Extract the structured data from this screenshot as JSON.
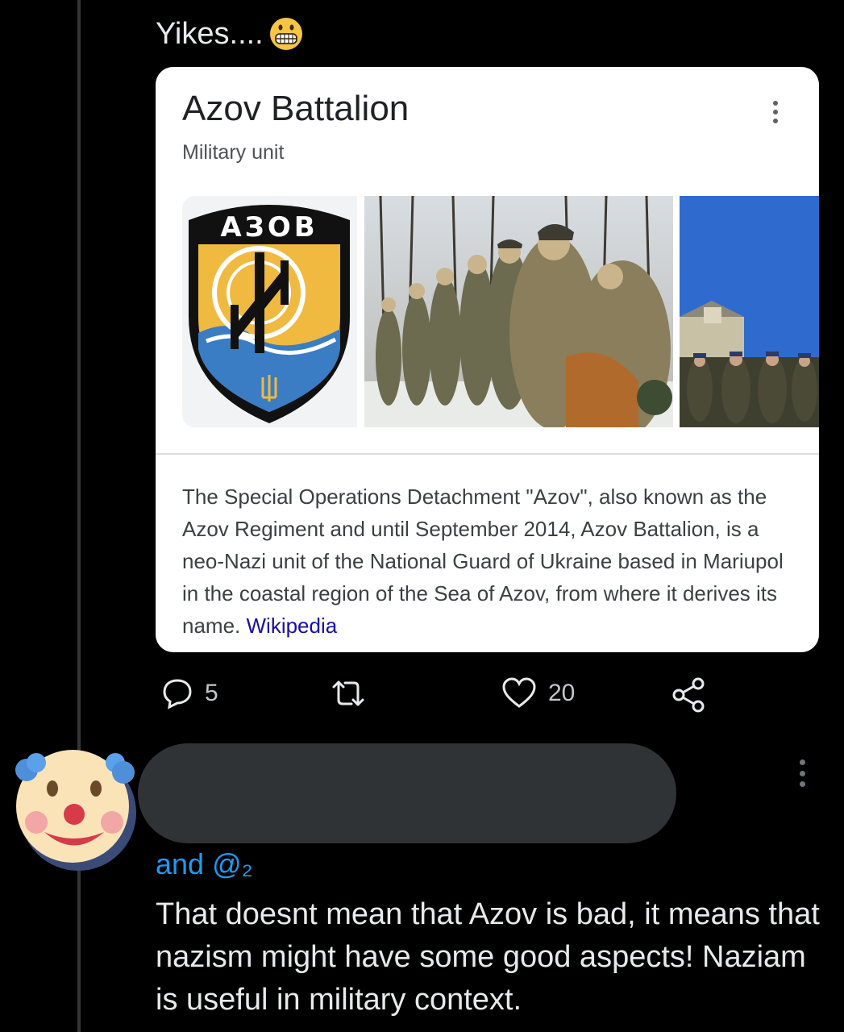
{
  "tweet": {
    "text": "Yikes....",
    "emoji": "grimacing-face-emoji"
  },
  "card": {
    "title": "Azov Battalion",
    "subtitle": "Military unit",
    "emblem_text": "АЗОВ",
    "description": "The Special Operations Detachment \"Azov\", also known as the Azov Regiment and until September 2014, Azov Battalion, is a neo-Nazi unit of the National Guard of Ukraine based in Mariupol in the coastal region of the Sea of Azov, from where it derives its name.",
    "source_link": "Wikipedia",
    "menu_icon": "more-vert-icon"
  },
  "actions": {
    "reply_count": "5",
    "retweet_count": "",
    "like_count": "20",
    "icons": [
      "reply-icon",
      "retweet-icon",
      "like-icon",
      "share-icon"
    ]
  },
  "reply": {
    "replying_to": "and @₂",
    "text": "That doesnt mean that Azov is bad, it means that nazism might have some good aspects! Naziam is useful in military context.",
    "avatar": "clown-face-avatar",
    "more_icon": "more-vert-icon"
  },
  "colors": {
    "background": "#000000",
    "link_blue": "#1d9bf0",
    "wiki_link": "#1a0dab",
    "card_bg": "#ffffff"
  }
}
